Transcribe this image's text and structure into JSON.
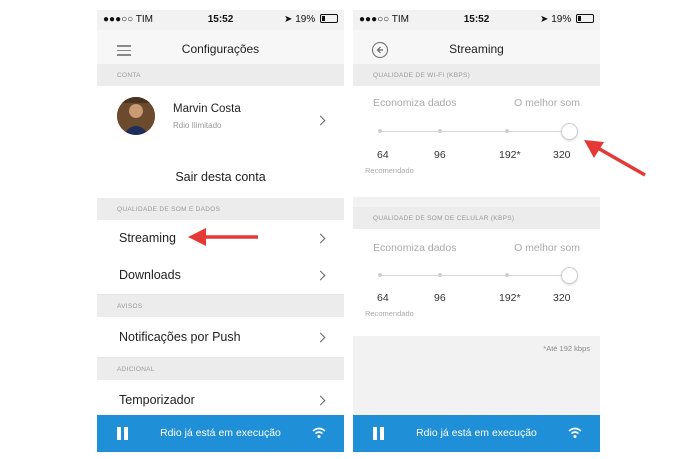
{
  "statusbar": {
    "carrier": "●●●○○ TIM",
    "time": "15:52",
    "battery": "19%"
  },
  "left_screen": {
    "title": "Configurações",
    "sections": {
      "conta": "CONTA",
      "som_dados": "QUALIDADE DE SOM E DADOS",
      "avisos": "AVISOS",
      "adicional": "ADICIONAL"
    },
    "profile": {
      "name": "Marvin Costa",
      "subtitle": "Rdio Ilimitado"
    },
    "logout": "Sair desta conta",
    "items": {
      "streaming": "Streaming",
      "downloads": "Downloads",
      "push": "Notificações por Push",
      "timer": "Temporizador"
    }
  },
  "right_screen": {
    "title": "Streaming",
    "wifi_header": "QUALIDADE DE WI-FI (KBPS)",
    "cell_header": "QUALIDADE DE SOM DE CELULAR (KBPS)",
    "left_caption": "Economiza dados",
    "right_caption": "O melhor som",
    "ticks": [
      "64",
      "96",
      "192*",
      "320"
    ],
    "recommended": "Recomendado",
    "wifi_selected": "320",
    "cell_selected": "320",
    "footnote": "*Até 192 kbps"
  },
  "player": {
    "text": "Rdio já está em execução"
  },
  "colors": {
    "accent": "#1f8fd8",
    "arrow": "#e53935"
  }
}
